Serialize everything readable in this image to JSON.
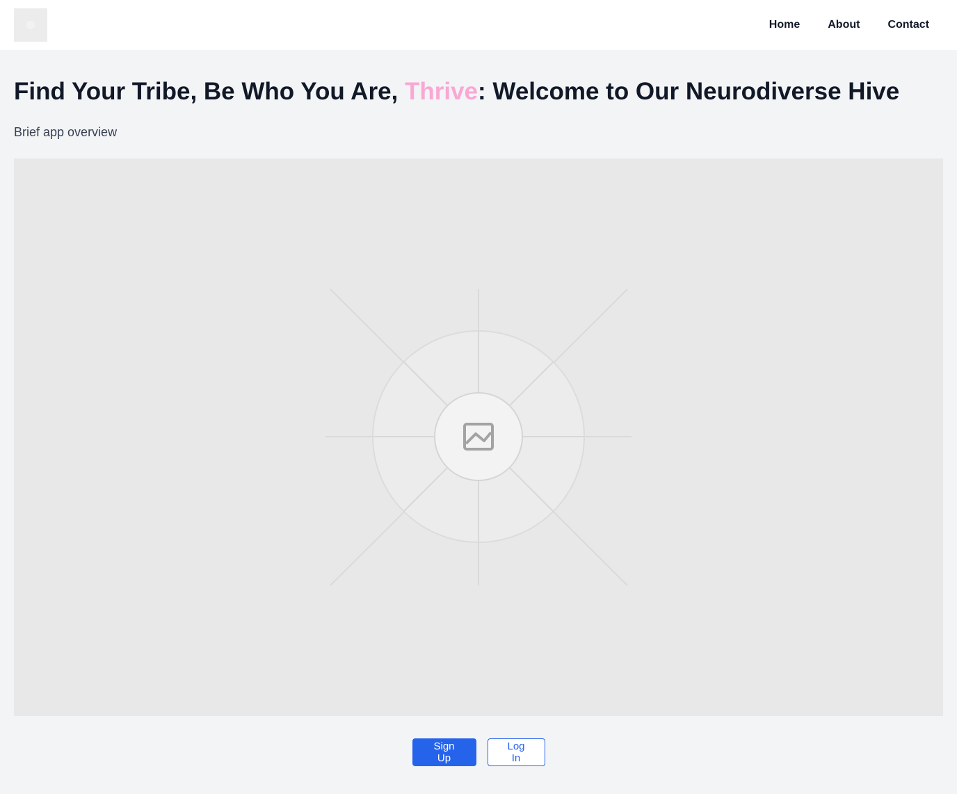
{
  "nav": {
    "logo_icon": "logo-placeholder",
    "links": [
      {
        "label": "Home"
      },
      {
        "label": "About"
      },
      {
        "label": "Contact"
      }
    ]
  },
  "hero": {
    "title_before": "Find Your Tribe, Be Who You Are, ",
    "title_accent": "Thrive",
    "title_after": ": Welcome to Our Neurodiverse Hive",
    "accent_color": "#f9a8d4",
    "subtitle": "Brief app overview",
    "image_icon": "image-placeholder-icon"
  },
  "actions": {
    "signup_label": "Sign Up",
    "login_label": "Log In",
    "primary_color": "#2563eb"
  }
}
